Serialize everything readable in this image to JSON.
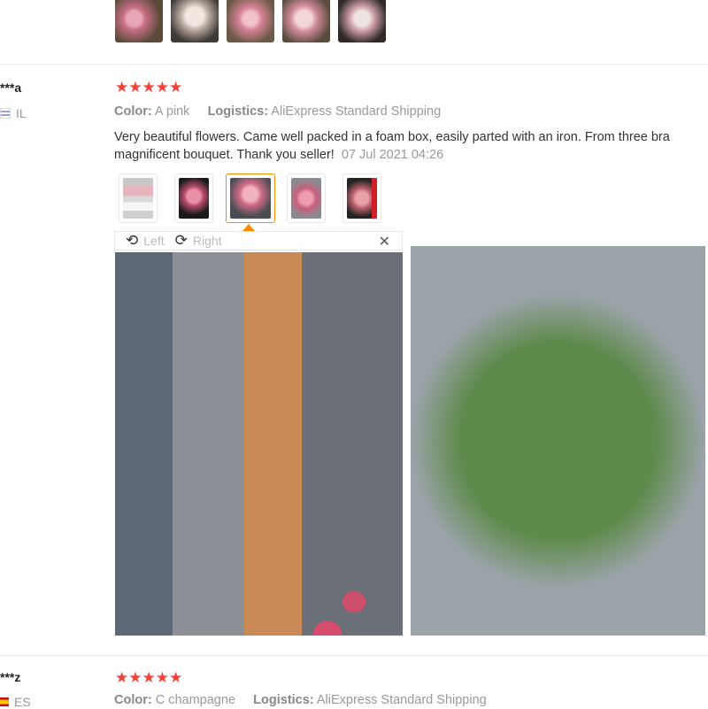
{
  "review1": {
    "name": "***a",
    "country": "IL",
    "stars": "★★★★★",
    "color_label": "Color:",
    "color_value": "A pink",
    "logistics_label": "Logistics:",
    "logistics_value": "AliExpress Standard Shipping",
    "text_line1": "Very beautiful flowers. Came well packed in a foam box, easily parted with an iron. From three bra",
    "text_line2": "magnificent bouquet. Thank you seller!",
    "date": "07 Jul 2021 04:26"
  },
  "viewer": {
    "left_label": "Left",
    "right_label": "Right",
    "left_icon": "rotate-left-icon",
    "right_icon": "rotate-right-icon",
    "close_icon": "close-icon"
  },
  "review2": {
    "name": "***z",
    "country": "ES",
    "stars": "★★★★★",
    "color_label": "Color:",
    "color_value": "C champagne",
    "logistics_label": "Logistics:",
    "logistics_value": "AliExpress Standard Shipping"
  },
  "colors": {
    "star": "#f44336",
    "active_border": "#ff8a00",
    "muted_text": "#999999"
  }
}
